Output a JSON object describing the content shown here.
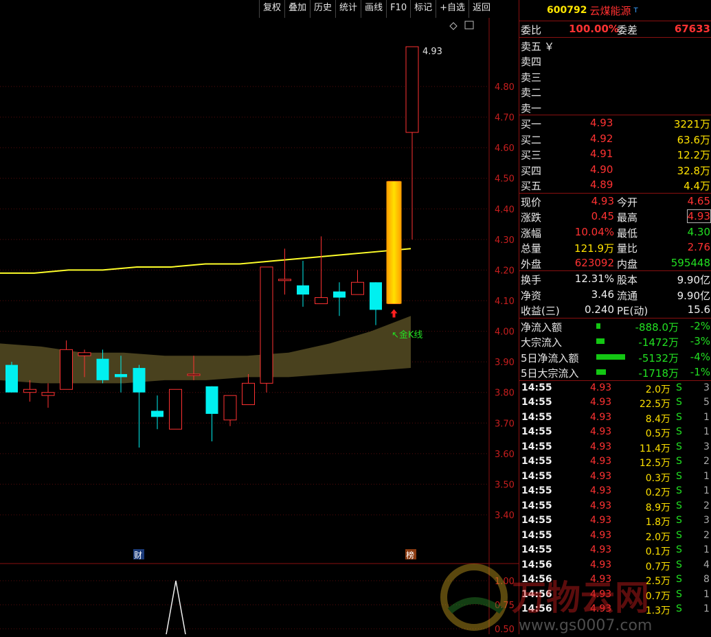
{
  "toolbar": {
    "items": [
      "复权",
      "叠加",
      "历史",
      "统计",
      "画线",
      "F10",
      "标记",
      "+自选",
      "返回"
    ]
  },
  "stock": {
    "code": "600792",
    "name": "云煤能源",
    "flag": "T"
  },
  "order_ratio": {
    "label1": "委比",
    "value1": "100.00%",
    "label2": "委差",
    "value2": "67633"
  },
  "asks": [
    {
      "label": "卖五",
      "extra": "￥"
    },
    {
      "label": "卖四",
      "extra": ""
    },
    {
      "label": "卖三",
      "extra": ""
    },
    {
      "label": "卖二",
      "extra": ""
    },
    {
      "label": "卖一",
      "extra": ""
    }
  ],
  "bids": [
    {
      "label": "买一",
      "price": "4.93",
      "vol": "3221万"
    },
    {
      "label": "买二",
      "price": "4.92",
      "vol": "63.6万"
    },
    {
      "label": "买三",
      "price": "4.91",
      "vol": "12.2万"
    },
    {
      "label": "买四",
      "price": "4.90",
      "vol": "32.8万"
    },
    {
      "label": "买五",
      "price": "4.89",
      "vol": "4.4万"
    }
  ],
  "quote": [
    {
      "l1": "现价",
      "v1": "4.93",
      "c1": "red",
      "l2": "今开",
      "v2": "4.65",
      "c2": "red"
    },
    {
      "l1": "涨跌",
      "v1": "0.45",
      "c1": "red",
      "l2": "最高",
      "v2": "4.93",
      "c2": "red"
    },
    {
      "l1": "涨幅",
      "v1": "10.04%",
      "c1": "red",
      "l2": "最低",
      "v2": "4.30",
      "c2": "green"
    },
    {
      "l1": "总量",
      "v1": "121.9万",
      "c1": "yellow",
      "l2": "量比",
      "v2": "2.76",
      "c2": "red"
    },
    {
      "l1": "外盘",
      "v1": "623092",
      "c1": "red",
      "l2": "内盘",
      "v2": "595448",
      "c2": "green"
    }
  ],
  "fundamentals": [
    {
      "l1": "换手",
      "v1": "12.31%",
      "l2": "股本",
      "v2": "9.90亿"
    },
    {
      "l1": "净资",
      "v1": "3.46",
      "l2": "流通",
      "v2": "9.90亿"
    },
    {
      "l1": "收益(三)",
      "v1": "0.240",
      "l2": "PE(动)",
      "v2": "15.6"
    }
  ],
  "flows": [
    {
      "label": "净流入额",
      "value": "-888.0万",
      "pct": "-2%",
      "bar": 0.06
    },
    {
      "label": "大宗流入",
      "value": "-1472万",
      "pct": "-3%",
      "bar": 0.12
    },
    {
      "label": "5日净流入额",
      "value": "-5132万",
      "pct": "-4%",
      "bar": 0.42
    },
    {
      "label": "5日大宗流入",
      "value": "-1718万",
      "pct": "-1%",
      "bar": 0.14
    }
  ],
  "ticks": [
    {
      "time": "14:55",
      "price": "4.93",
      "vol": "2.0万",
      "bs": "S",
      "n": "3"
    },
    {
      "time": "14:55",
      "price": "4.93",
      "vol": "22.5万",
      "bs": "S",
      "n": "5"
    },
    {
      "time": "14:55",
      "price": "4.93",
      "vol": "8.4万",
      "bs": "S",
      "n": "1"
    },
    {
      "time": "14:55",
      "price": "4.93",
      "vol": "0.5万",
      "bs": "S",
      "n": "1"
    },
    {
      "time": "14:55",
      "price": "4.93",
      "vol": "11.4万",
      "bs": "S",
      "n": "3"
    },
    {
      "time": "14:55",
      "price": "4.93",
      "vol": "12.5万",
      "bs": "S",
      "n": "2"
    },
    {
      "time": "14:55",
      "price": "4.93",
      "vol": "0.3万",
      "bs": "S",
      "n": "1"
    },
    {
      "time": "14:55",
      "price": "4.93",
      "vol": "0.2万",
      "bs": "S",
      "n": "1"
    },
    {
      "time": "14:55",
      "price": "4.93",
      "vol": "8.9万",
      "bs": "S",
      "n": "2"
    },
    {
      "time": "14:55",
      "price": "4.93",
      "vol": "1.8万",
      "bs": "S",
      "n": "3"
    },
    {
      "time": "14:55",
      "price": "4.93",
      "vol": "2.0万",
      "bs": "S",
      "n": "2"
    },
    {
      "time": "14:55",
      "price": "4.93",
      "vol": "0.1万",
      "bs": "S",
      "n": "1"
    },
    {
      "time": "14:56",
      "price": "4.93",
      "vol": "0.7万",
      "bs": "S",
      "n": "4"
    },
    {
      "time": "14:56",
      "price": "4.93",
      "vol": "2.5万",
      "bs": "S",
      "n": "8"
    },
    {
      "time": "14:56",
      "price": "4.93",
      "vol": "0.7万",
      "bs": "S",
      "n": "1"
    },
    {
      "time": "14:56",
      "price": "4.93",
      "vol": "1.3万",
      "bs": "S",
      "n": "1"
    }
  ],
  "chart_data": {
    "type": "candlestick",
    "price_axis_ticks": [
      "4.80",
      "4.70",
      "4.60",
      "4.50",
      "4.40",
      "4.30",
      "4.20",
      "4.10",
      "4.00",
      "3.90",
      "3.80",
      "3.70",
      "3.60",
      "3.50",
      "3.40"
    ],
    "lower_axis_ticks": [
      "1.00",
      "0.75",
      "0.50"
    ],
    "last_price_label": "4.93",
    "golden_k_label": "↖金K线",
    "markers": [
      {
        "text": "财"
      },
      {
        "text": "榜"
      }
    ],
    "candles": [
      {
        "o": 3.89,
        "h": 3.9,
        "l": 3.8,
        "c": 3.8
      },
      {
        "o": 3.8,
        "h": 3.84,
        "l": 3.77,
        "c": 3.81
      },
      {
        "o": 3.79,
        "h": 3.83,
        "l": 3.75,
        "c": 3.8
      },
      {
        "o": 3.81,
        "h": 3.97,
        "l": 3.81,
        "c": 3.94
      },
      {
        "o": 3.92,
        "h": 3.94,
        "l": 3.85,
        "c": 3.93
      },
      {
        "o": 3.91,
        "h": 3.94,
        "l": 3.83,
        "c": 3.84
      },
      {
        "o": 3.86,
        "h": 3.92,
        "l": 3.8,
        "c": 3.85
      },
      {
        "o": 3.88,
        "h": 3.89,
        "l": 3.62,
        "c": 3.8
      },
      {
        "o": 3.74,
        "h": 3.79,
        "l": 3.68,
        "c": 3.72
      },
      {
        "o": 3.68,
        "h": 3.81,
        "l": 3.68,
        "c": 3.81
      },
      {
        "o": 3.86,
        "h": 3.92,
        "l": 3.84,
        "c": 3.86
      },
      {
        "o": 3.82,
        "h": 3.82,
        "l": 3.64,
        "c": 3.73
      },
      {
        "o": 3.71,
        "h": 3.79,
        "l": 3.69,
        "c": 3.79
      },
      {
        "o": 3.76,
        "h": 3.86,
        "l": 3.76,
        "c": 3.83
      },
      {
        "o": 3.83,
        "h": 4.21,
        "l": 3.8,
        "c": 4.21
      },
      {
        "o": 4.17,
        "h": 4.27,
        "l": 4.12,
        "c": 4.17
      },
      {
        "o": 4.15,
        "h": 4.23,
        "l": 4.08,
        "c": 4.12
      },
      {
        "o": 4.09,
        "h": 4.31,
        "l": 4.09,
        "c": 4.11
      },
      {
        "o": 4.13,
        "h": 4.16,
        "l": 4.05,
        "c": 4.11
      },
      {
        "o": 4.12,
        "h": 4.2,
        "l": 4.12,
        "c": 4.16
      },
      {
        "o": 4.16,
        "h": 4.16,
        "l": 4.02,
        "c": 4.07
      },
      {
        "o": 4.09,
        "h": 4.49,
        "l": 4.09,
        "c": 4.49
      },
      {
        "o": 4.65,
        "h": 4.93,
        "l": 4.3,
        "c": 4.93
      }
    ],
    "ma_line": [
      4.19,
      4.19,
      4.2,
      4.2,
      4.21,
      4.21,
      4.22,
      4.22,
      4.23,
      4.24,
      4.25,
      4.26,
      4.27
    ],
    "band_upper": [
      3.96,
      3.95,
      3.93,
      3.93,
      3.92,
      3.92,
      3.92,
      3.93,
      3.96,
      4.0,
      4.05
    ],
    "band_lower": [
      3.84,
      3.83,
      3.83,
      3.83,
      3.84,
      3.84,
      3.85,
      3.85,
      3.86,
      3.87,
      3.88
    ],
    "lower_indicator": [
      0.0,
      1.0,
      0.0
    ],
    "colors": {
      "up": "#ff3232",
      "down": "#00f0f0",
      "ma": "#ffff2a",
      "band": "#4d4420",
      "highlight": "#ffb400"
    }
  }
}
